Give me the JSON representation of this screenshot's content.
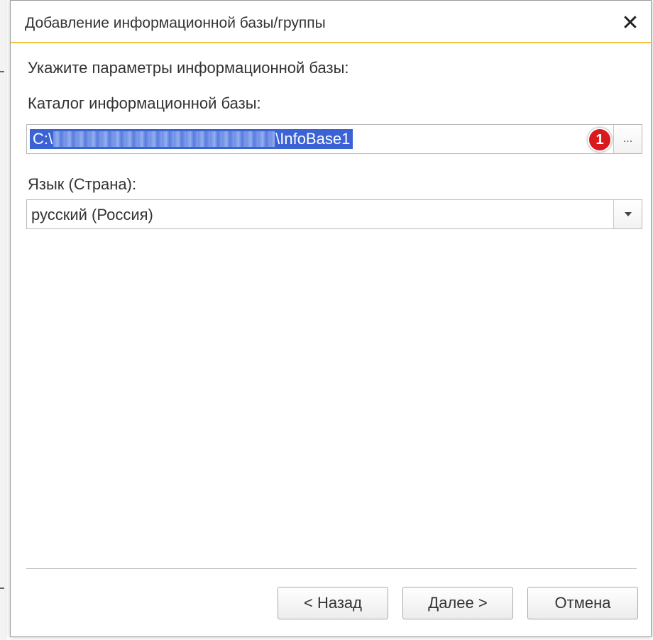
{
  "dialog": {
    "title": "Добавление информационной базы/группы",
    "close_label": "✕"
  },
  "form": {
    "heading": "Укажите параметры информационной базы:",
    "catalog_label": "Каталог информационной базы:",
    "catalog_value_prefix": "C:\\",
    "catalog_value_suffix": "\\InfoBase1",
    "badge_number": "1",
    "browse_label": "...",
    "language_label": "Язык (Страна):",
    "language_value": "русский (Россия)"
  },
  "buttons": {
    "back": "< Назад",
    "next": "Далее >",
    "cancel": "Отмена"
  },
  "colors": {
    "selection": "#3b63d6",
    "badge": "#d9191c",
    "title_accent": "#f3c343"
  }
}
